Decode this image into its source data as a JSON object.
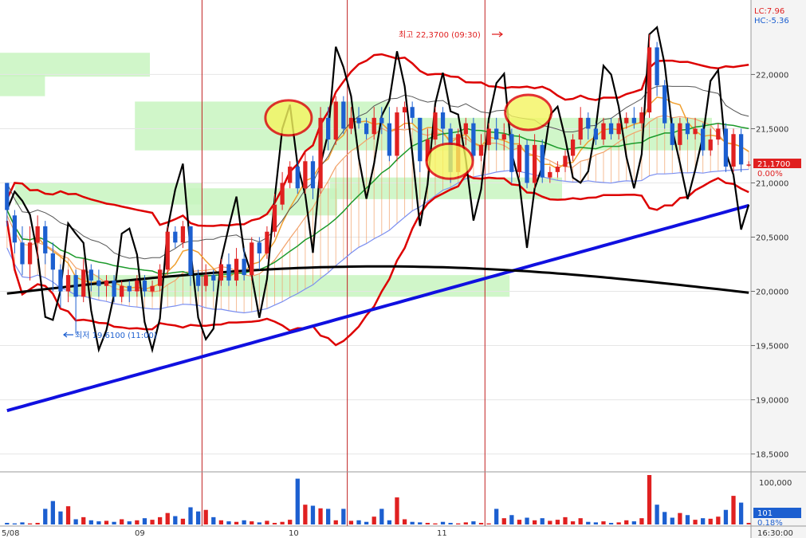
{
  "header": {
    "lc_label": "LC:7.96",
    "hc_label": "HC:-5.36"
  },
  "price_axis": {
    "ticks": [
      "22,0000",
      "21,5000",
      "21,0000",
      "20,5000",
      "20,0000",
      "19,5000",
      "19,0000",
      "18,5000"
    ],
    "current_price": "21,1700",
    "current_change": "0.00%"
  },
  "volume_axis": {
    "top_tick": "100,000",
    "current_volume": "101",
    "current_pct": "0.18%"
  },
  "time_axis": {
    "labels": [
      "5/08",
      "09",
      "10",
      "11"
    ],
    "clock": "16:30:00"
  },
  "annotations": {
    "high": "최고 22,3700 (09:30)",
    "low": "최저 19,6100 (11:00)"
  },
  "colors": {
    "up": "#e02020",
    "down": "#1c5fd0",
    "envelope": "#dd0000",
    "long_ma": "#1010e0",
    "black_ma": "#000000",
    "green_ma": "#1b9a2a",
    "orange_ma": "#f0a030",
    "zone": "#c8f5c0",
    "cloud": "#f2a26a",
    "annotation_bg": "#f5f560"
  },
  "chart_data": {
    "type": "candlestick",
    "ylim": [
      18.35,
      22.65
    ],
    "y_ticks": [
      22.0,
      21.5,
      21.0,
      20.5,
      20.0,
      19.5,
      19.0,
      18.5
    ],
    "session_breaks": [
      "09",
      "10",
      "11"
    ],
    "candles": [
      [
        21.0,
        20.75,
        21.0,
        20.6
      ],
      [
        20.7,
        20.45,
        20.75,
        20.35
      ],
      [
        20.45,
        20.25,
        20.6,
        20.15
      ],
      [
        20.25,
        20.45,
        20.6,
        20.1
      ],
      [
        20.45,
        20.6,
        20.7,
        20.3
      ],
      [
        20.6,
        20.35,
        20.65,
        20.25
      ],
      [
        20.35,
        20.2,
        20.45,
        20.0
      ],
      [
        20.2,
        20.0,
        20.25,
        19.85
      ],
      [
        20.0,
        20.15,
        20.2,
        19.9
      ],
      [
        20.15,
        19.95,
        20.2,
        19.61
      ],
      [
        19.95,
        20.2,
        20.3,
        19.9
      ],
      [
        20.2,
        20.1,
        20.25,
        20.0
      ],
      [
        20.1,
        20.05,
        20.2,
        19.95
      ],
      [
        20.05,
        20.1,
        20.15,
        19.95
      ],
      [
        20.1,
        19.95,
        20.15,
        19.9
      ],
      [
        19.95,
        20.05,
        20.1,
        19.9
      ],
      [
        20.05,
        20.0,
        20.1,
        19.9
      ],
      [
        20.0,
        20.1,
        20.15,
        19.95
      ],
      [
        20.1,
        20.0,
        20.15,
        19.95
      ],
      [
        20.0,
        20.05,
        20.1,
        19.95
      ],
      [
        20.05,
        20.2,
        20.25,
        20.0
      ],
      [
        20.2,
        20.55,
        20.6,
        20.15
      ],
      [
        20.55,
        20.45,
        20.6,
        20.4
      ],
      [
        20.45,
        20.6,
        20.65,
        20.4
      ],
      [
        20.6,
        20.15,
        20.6,
        20.05
      ],
      [
        20.15,
        20.05,
        20.2,
        20.0
      ],
      [
        20.05,
        20.15,
        20.25,
        20.0
      ],
      [
        20.15,
        20.1,
        20.2,
        20.0
      ],
      [
        20.1,
        20.25,
        20.3,
        20.05
      ],
      [
        20.25,
        20.1,
        20.35,
        20.05
      ],
      [
        20.1,
        20.3,
        20.4,
        20.05
      ],
      [
        20.3,
        20.15,
        20.4,
        20.1
      ],
      [
        20.15,
        20.45,
        20.5,
        20.1
      ],
      [
        20.45,
        20.35,
        20.5,
        20.2
      ],
      [
        20.35,
        20.55,
        20.6,
        20.3
      ],
      [
        20.55,
        20.8,
        20.9,
        20.5
      ],
      [
        20.8,
        21.0,
        21.1,
        20.75
      ],
      [
        21.0,
        21.15,
        21.2,
        20.95
      ],
      [
        21.15,
        20.95,
        21.2,
        20.9
      ],
      [
        20.95,
        21.2,
        21.3,
        20.9
      ],
      [
        21.2,
        20.95,
        21.25,
        20.85
      ],
      [
        20.95,
        21.6,
        21.7,
        20.9
      ],
      [
        21.6,
        21.4,
        21.7,
        21.3
      ],
      [
        21.4,
        21.75,
        21.8,
        21.35
      ],
      [
        21.75,
        21.5,
        21.8,
        21.45
      ],
      [
        21.5,
        21.6,
        21.7,
        21.45
      ],
      [
        21.6,
        21.55,
        21.7,
        21.5
      ],
      [
        21.55,
        21.45,
        21.6,
        21.4
      ],
      [
        21.45,
        21.6,
        21.7,
        21.4
      ],
      [
        21.6,
        21.55,
        21.7,
        21.45
      ],
      [
        21.55,
        21.25,
        21.7,
        21.2
      ],
      [
        21.25,
        21.65,
        21.7,
        21.2
      ],
      [
        21.65,
        21.7,
        21.75,
        21.5
      ],
      [
        21.7,
        21.6,
        21.75,
        21.55
      ],
      [
        21.6,
        21.2,
        21.6,
        21.1
      ],
      [
        21.2,
        21.4,
        21.5,
        21.15
      ],
      [
        21.4,
        21.65,
        21.7,
        21.35
      ],
      [
        21.65,
        21.5,
        21.7,
        21.35
      ],
      [
        21.5,
        21.1,
        21.55,
        21.0
      ],
      [
        21.1,
        21.45,
        21.5,
        21.05
      ],
      [
        21.45,
        21.55,
        21.6,
        21.35
      ],
      [
        21.55,
        21.25,
        21.6,
        21.2
      ],
      [
        21.25,
        21.35,
        21.45,
        21.2
      ],
      [
        21.35,
        21.5,
        21.55,
        21.3
      ],
      [
        21.5,
        21.4,
        21.6,
        21.3
      ],
      [
        21.4,
        21.45,
        21.55,
        21.3
      ],
      [
        21.45,
        21.1,
        21.5,
        21.0
      ],
      [
        21.1,
        21.35,
        21.45,
        21.05
      ],
      [
        21.35,
        21.0,
        21.4,
        20.95
      ],
      [
        21.0,
        21.35,
        21.45,
        20.95
      ],
      [
        21.35,
        21.05,
        21.4,
        21.0
      ],
      [
        21.05,
        21.1,
        21.15,
        21.0
      ],
      [
        21.1,
        21.15,
        21.2,
        21.05
      ],
      [
        21.15,
        21.25,
        21.3,
        21.1
      ],
      [
        21.25,
        21.4,
        21.45,
        21.2
      ],
      [
        21.4,
        21.6,
        21.7,
        21.35
      ],
      [
        21.6,
        21.5,
        21.65,
        21.4
      ],
      [
        21.5,
        21.4,
        21.55,
        21.35
      ],
      [
        21.4,
        21.55,
        21.6,
        21.35
      ],
      [
        21.55,
        21.45,
        21.6,
        21.4
      ],
      [
        21.45,
        21.55,
        21.6,
        21.4
      ],
      [
        21.55,
        21.6,
        21.65,
        21.5
      ],
      [
        21.6,
        21.55,
        21.7,
        21.5
      ],
      [
        21.55,
        21.65,
        21.7,
        21.5
      ],
      [
        21.65,
        22.25,
        22.37,
        21.6
      ],
      [
        22.25,
        21.9,
        22.3,
        21.8
      ],
      [
        21.9,
        21.55,
        21.95,
        21.5
      ],
      [
        21.55,
        21.35,
        21.6,
        21.3
      ],
      [
        21.35,
        21.55,
        21.6,
        21.3
      ],
      [
        21.55,
        21.45,
        21.6,
        21.4
      ],
      [
        21.45,
        21.5,
        21.6,
        21.4
      ],
      [
        21.5,
        21.3,
        21.55,
        21.25
      ],
      [
        21.3,
        21.4,
        21.5,
        21.25
      ],
      [
        21.4,
        21.5,
        21.55,
        21.35
      ],
      [
        21.5,
        21.15,
        21.55,
        21.1
      ],
      [
        21.15,
        21.45,
        21.5,
        21.1
      ],
      [
        21.45,
        21.17,
        21.5,
        21.1
      ],
      [
        21.17,
        21.17,
        21.2,
        21.15
      ]
    ],
    "volume": [
      3,
      2,
      4,
      2,
      3,
      30,
      45,
      25,
      35,
      10,
      14,
      8,
      6,
      7,
      5,
      10,
      6,
      8,
      12,
      9,
      14,
      22,
      16,
      11,
      33,
      25,
      28,
      14,
      8,
      6,
      5,
      8,
      6,
      4,
      7,
      3,
      5,
      9,
      88,
      38,
      36,
      31,
      30,
      8,
      30,
      7,
      8,
      5,
      15,
      30,
      8,
      52,
      10,
      5,
      4,
      3,
      2,
      5,
      3,
      2,
      4,
      6,
      3,
      2,
      30,
      12,
      18,
      9,
      13,
      8,
      12,
      7,
      9,
      14,
      6,
      12,
      5,
      4,
      6,
      3,
      4,
      8,
      6,
      12,
      95,
      38,
      24,
      13,
      22,
      18,
      9,
      12,
      11,
      15,
      28,
      55,
      42,
      3
    ]
  }
}
